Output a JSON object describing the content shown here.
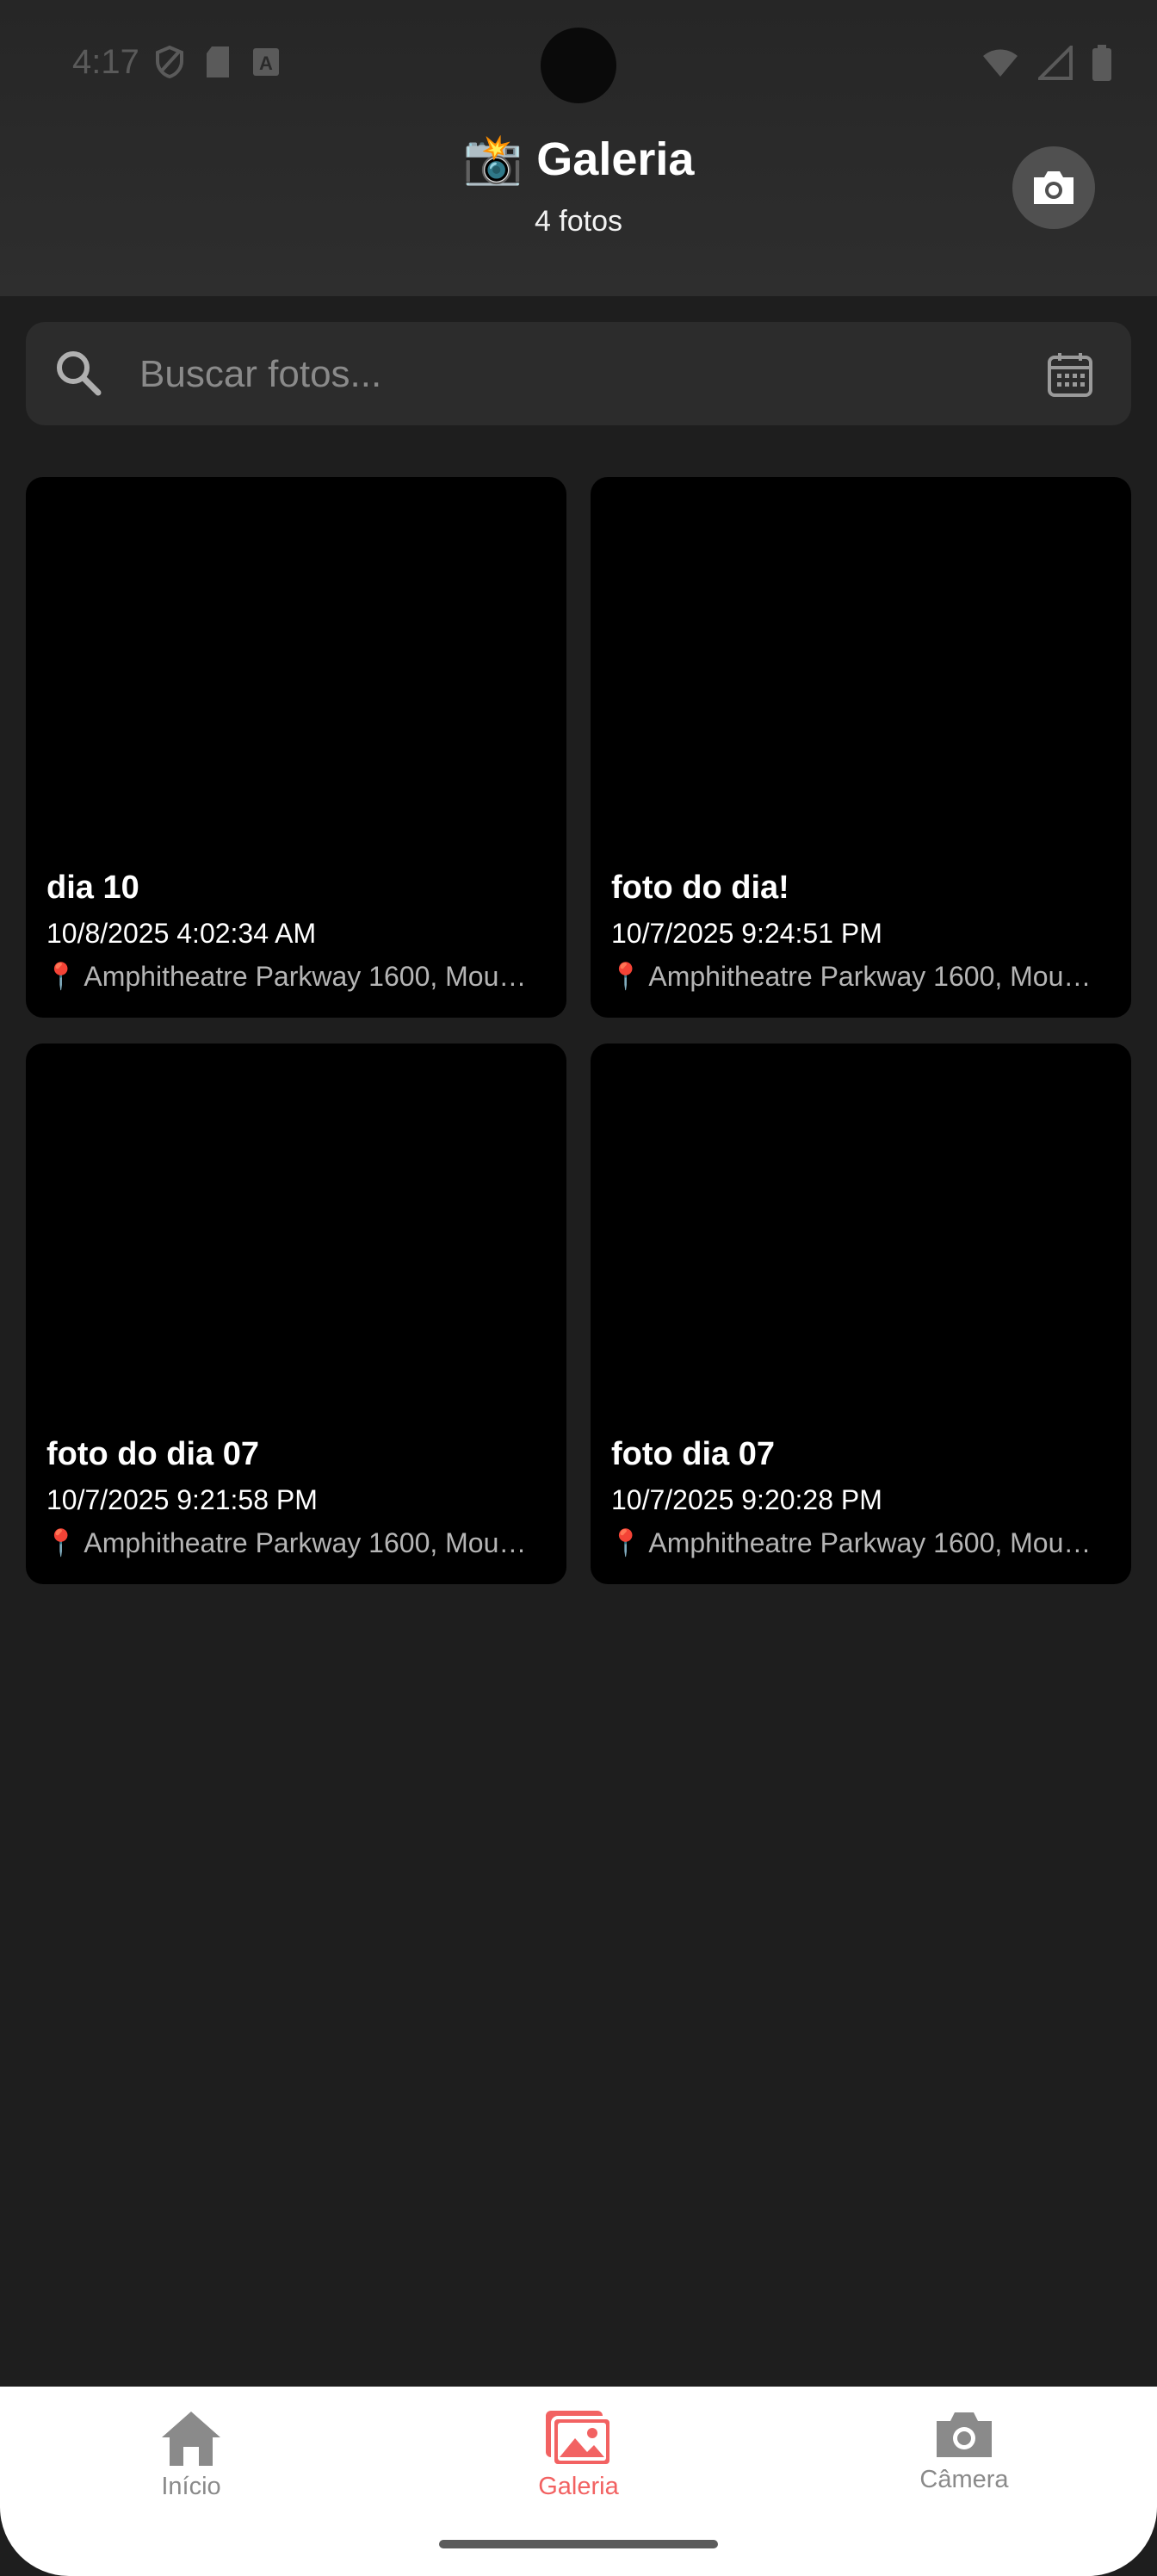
{
  "status_bar": {
    "time": "4:17"
  },
  "header": {
    "emoji": "📸",
    "title": "Galeria",
    "subtitle": "4 fotos",
    "camera_button_icon": "camera-icon"
  },
  "search": {
    "placeholder": "Buscar fotos...",
    "value": "",
    "left_icon": "search-icon",
    "right_icon": "calendar-icon"
  },
  "photos": [
    {
      "title": "dia 10",
      "date": "10/8/2025 4:02:34 AM",
      "location": "Amphitheatre Parkway 1600, Mou…"
    },
    {
      "title": "foto do dia!",
      "date": "10/7/2025 9:24:51 PM",
      "location": "Amphitheatre Parkway 1600, Mou…"
    },
    {
      "title": "foto do dia 07",
      "date": "10/7/2025 9:21:58 PM",
      "location": "Amphitheatre Parkway 1600, Mou…"
    },
    {
      "title": "foto dia 07",
      "date": "10/7/2025 9:20:28 PM",
      "location": "Amphitheatre Parkway 1600, Mou…"
    }
  ],
  "tabs": [
    {
      "label": "Início",
      "icon": "home-icon",
      "active": false
    },
    {
      "label": "Galeria",
      "icon": "gallery-icon",
      "active": true
    },
    {
      "label": "Câmera",
      "icon": "camera-icon",
      "active": false
    }
  ],
  "colors": {
    "background": "#1e1e1e",
    "accent": "#f26262",
    "inactive": "#8a8a8a",
    "card": "#000000"
  }
}
